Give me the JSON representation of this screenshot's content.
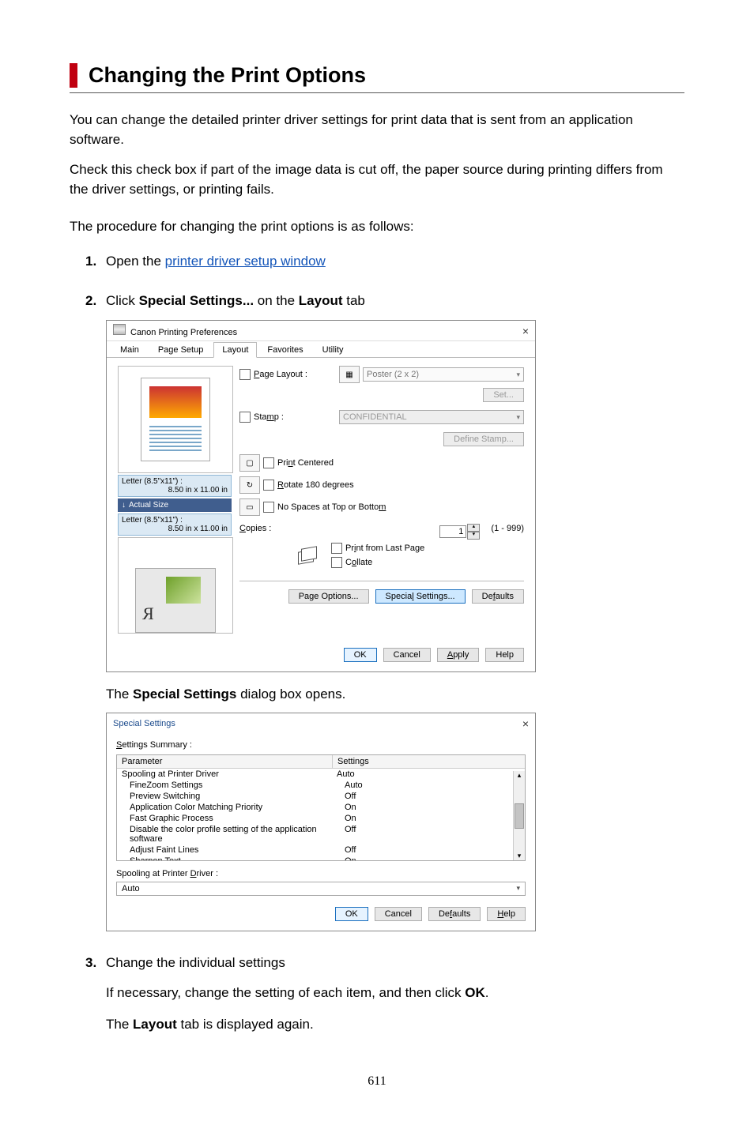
{
  "title": "Changing the Print Options",
  "intro1": "You can change the detailed printer driver settings for print data that is sent from an application software.",
  "intro2": "Check this check box if part of the image data is cut off, the paper source during printing differs from the driver settings, or printing fails.",
  "intro3": "The procedure for changing the print options is as follows:",
  "step1_prefix": "Open the ",
  "step1_link": "printer driver setup window",
  "step2_prefix": "Click ",
  "step2_bold": "Special Settings...",
  "step2_mid": " on the ",
  "step2_bold2": "Layout",
  "step2_suffix": " tab",
  "step2_result_pre": "The ",
  "step2_result_bold": "Special Settings",
  "step2_result_post": " dialog box opens.",
  "step3_text": "Change the individual settings",
  "step3_body_pre": "If necessary, change the setting of each item, and then click ",
  "step3_body_bold": "OK",
  "step3_body_post": ".",
  "step3_body2_pre": "The ",
  "step3_body2_bold": "Layout",
  "step3_body2_post": " tab is displayed again.",
  "page_number": "611",
  "dlg1": {
    "title": "Canon                 Printing Preferences",
    "tabs": [
      "Main",
      "Page Setup",
      "Layout",
      "Favorites",
      "Utility"
    ],
    "page_layout_label": "Page Layout :",
    "page_layout_value": "Poster (2 x 2)",
    "set_btn": "Set...",
    "stamp_label": "Stamp :",
    "stamp_value": "CONFIDENTIAL",
    "define_stamp_btn": "Define Stamp...",
    "size1_line1": "Letter (8.5\"x11\") :",
    "size1_line2": "8.50 in x 11.00 in",
    "actual_size": "Actual Size",
    "size2_line1": "Letter (8.5\"x11\") :",
    "size2_line2": "8.50 in x 11.00 in",
    "print_centered": "Print Centered",
    "rotate180": "Rotate 180 degrees",
    "no_spaces": "No Spaces at Top or Bottom",
    "copies_label": "Copies :",
    "copies_value": "1",
    "copies_range": "(1 - 999)",
    "print_last": "Print from Last Page",
    "collate": "Collate",
    "page_options_btn": "Page Options...",
    "special_settings_btn": "Special Settings...",
    "defaults_btn": "Defaults",
    "ok": "OK",
    "cancel": "Cancel",
    "apply": "Apply",
    "help": "Help"
  },
  "dlg2": {
    "title": "Special Settings",
    "summary_label": "Settings Summary :",
    "col_param": "Parameter",
    "col_set": "Settings",
    "rows": [
      {
        "p": "Spooling at Printer Driver",
        "v": "Auto"
      },
      {
        "p": "FineZoom Settings",
        "v": "Auto"
      },
      {
        "p": "Preview Switching",
        "v": "Off"
      },
      {
        "p": "Application Color Matching Priority",
        "v": "On"
      },
      {
        "p": "Fast Graphic Process",
        "v": "On"
      },
      {
        "p": "Disable the color profile setting of the application software",
        "v": "Off"
      },
      {
        "p": "Adjust Faint Lines",
        "v": "Off"
      },
      {
        "p": "Sharpen Text",
        "v": "On"
      }
    ],
    "detail_label": "Spooling at Printer Driver :",
    "detail_value": "Auto",
    "ok": "OK",
    "cancel": "Cancel",
    "defaults": "Defaults",
    "help": "Help"
  }
}
